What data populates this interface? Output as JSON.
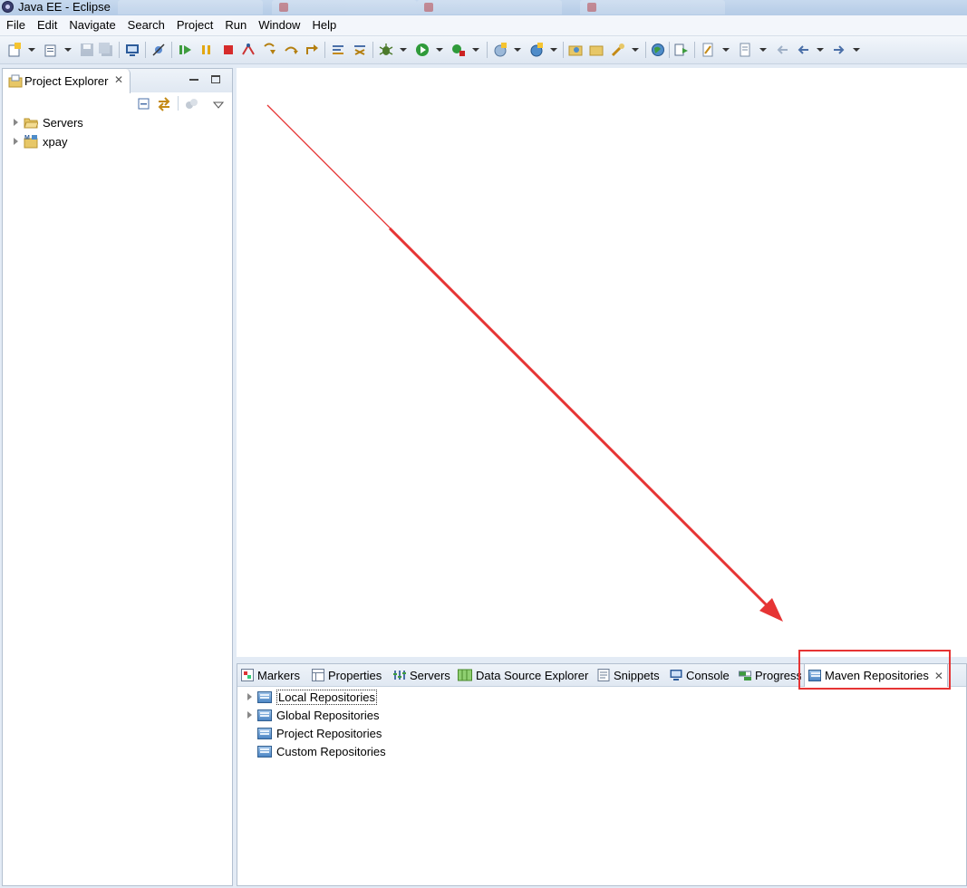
{
  "window": {
    "title": "Java EE - Eclipse"
  },
  "menu": [
    "File",
    "Edit",
    "Navigate",
    "Search",
    "Project",
    "Run",
    "Window",
    "Help"
  ],
  "toolbar": {
    "icons": [
      "new-icon",
      "new-wizard-icon",
      "save-icon",
      "save-all-icon",
      "open-console-icon",
      "skip-breakpoints-icon",
      "resume-icon",
      "suspend-icon",
      "terminate-icon",
      "disconnect-icon",
      "step-into-icon",
      "step-over-icon",
      "step-return-icon",
      "use-step-filters-icon",
      "drop-to-frame-icon",
      "debug-icon",
      "run-icon",
      "run-external-tool-icon",
      "new-server-icon",
      "new-class-icon",
      "open-type-icon",
      "open-task-icon",
      "search-icon",
      "globe-icon",
      "next-annotation-icon",
      "prev-annotation-icon",
      "last-edit-icon",
      "back-icon",
      "forward-icon"
    ]
  },
  "project_explorer": {
    "title": "Project Explorer",
    "items": [
      {
        "label": "Servers",
        "icon": "folder-icon"
      },
      {
        "label": "xpay",
        "icon": "maven-project-icon"
      }
    ]
  },
  "bottom_panel": {
    "tabs": [
      {
        "label": "Markers",
        "icon": "markers-icon"
      },
      {
        "label": "Properties",
        "icon": "properties-icon"
      },
      {
        "label": "Servers",
        "icon": "servers-icon"
      },
      {
        "label": "Data Source Explorer",
        "icon": "data-source-icon"
      },
      {
        "label": "Snippets",
        "icon": "snippets-icon"
      },
      {
        "label": "Console",
        "icon": "console-icon"
      },
      {
        "label": "Progress",
        "icon": "progress-icon"
      },
      {
        "label": "Maven Repositories",
        "icon": "maven-repo-icon",
        "active": true
      }
    ],
    "repositories": [
      {
        "label": "Local Repositories",
        "expandable": true
      },
      {
        "label": "Global Repositories",
        "expandable": true
      },
      {
        "label": "Project Repositories",
        "expandable": false
      },
      {
        "label": "Custom Repositories",
        "expandable": false
      }
    ]
  },
  "colors": {
    "annotation": "#e63434",
    "chrome": "#e3ebf5"
  }
}
